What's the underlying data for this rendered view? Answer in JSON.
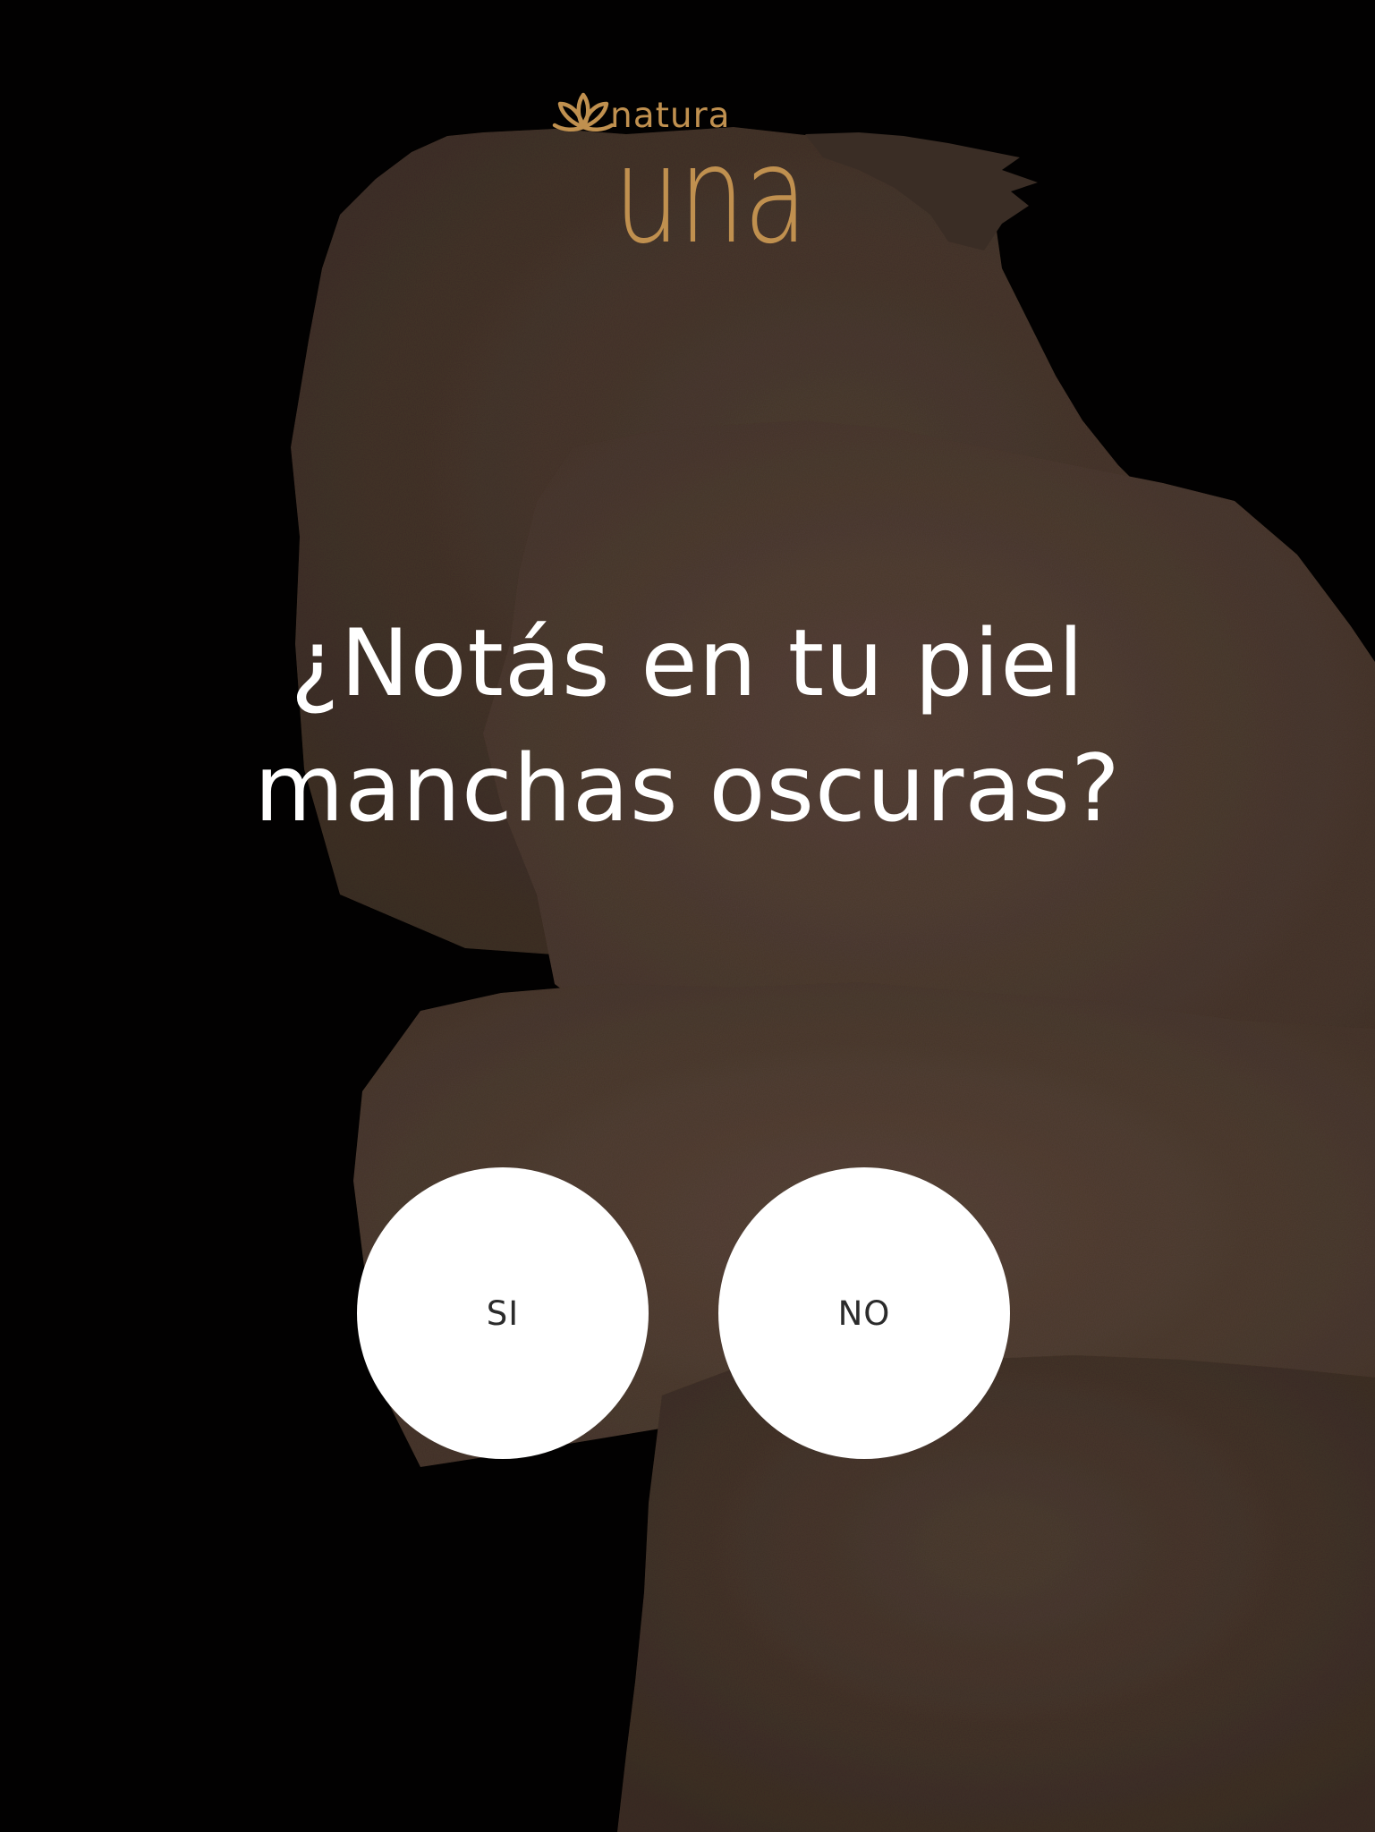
{
  "brand": {
    "company": "natura",
    "line": "una",
    "logo_icon": "natura-flower-icon",
    "gold_color": "#c0904f"
  },
  "quiz": {
    "question_line1": "¿Notás en tu piel",
    "question_line2": "manchas oscuras?",
    "answers": {
      "yes_label": "SI",
      "no_label": "NO"
    }
  },
  "colors": {
    "background": "#020101",
    "texture": "#4a3a30",
    "button": "#ffffff",
    "button_text": "#2b2b2b",
    "question_text": "#ffffff"
  }
}
